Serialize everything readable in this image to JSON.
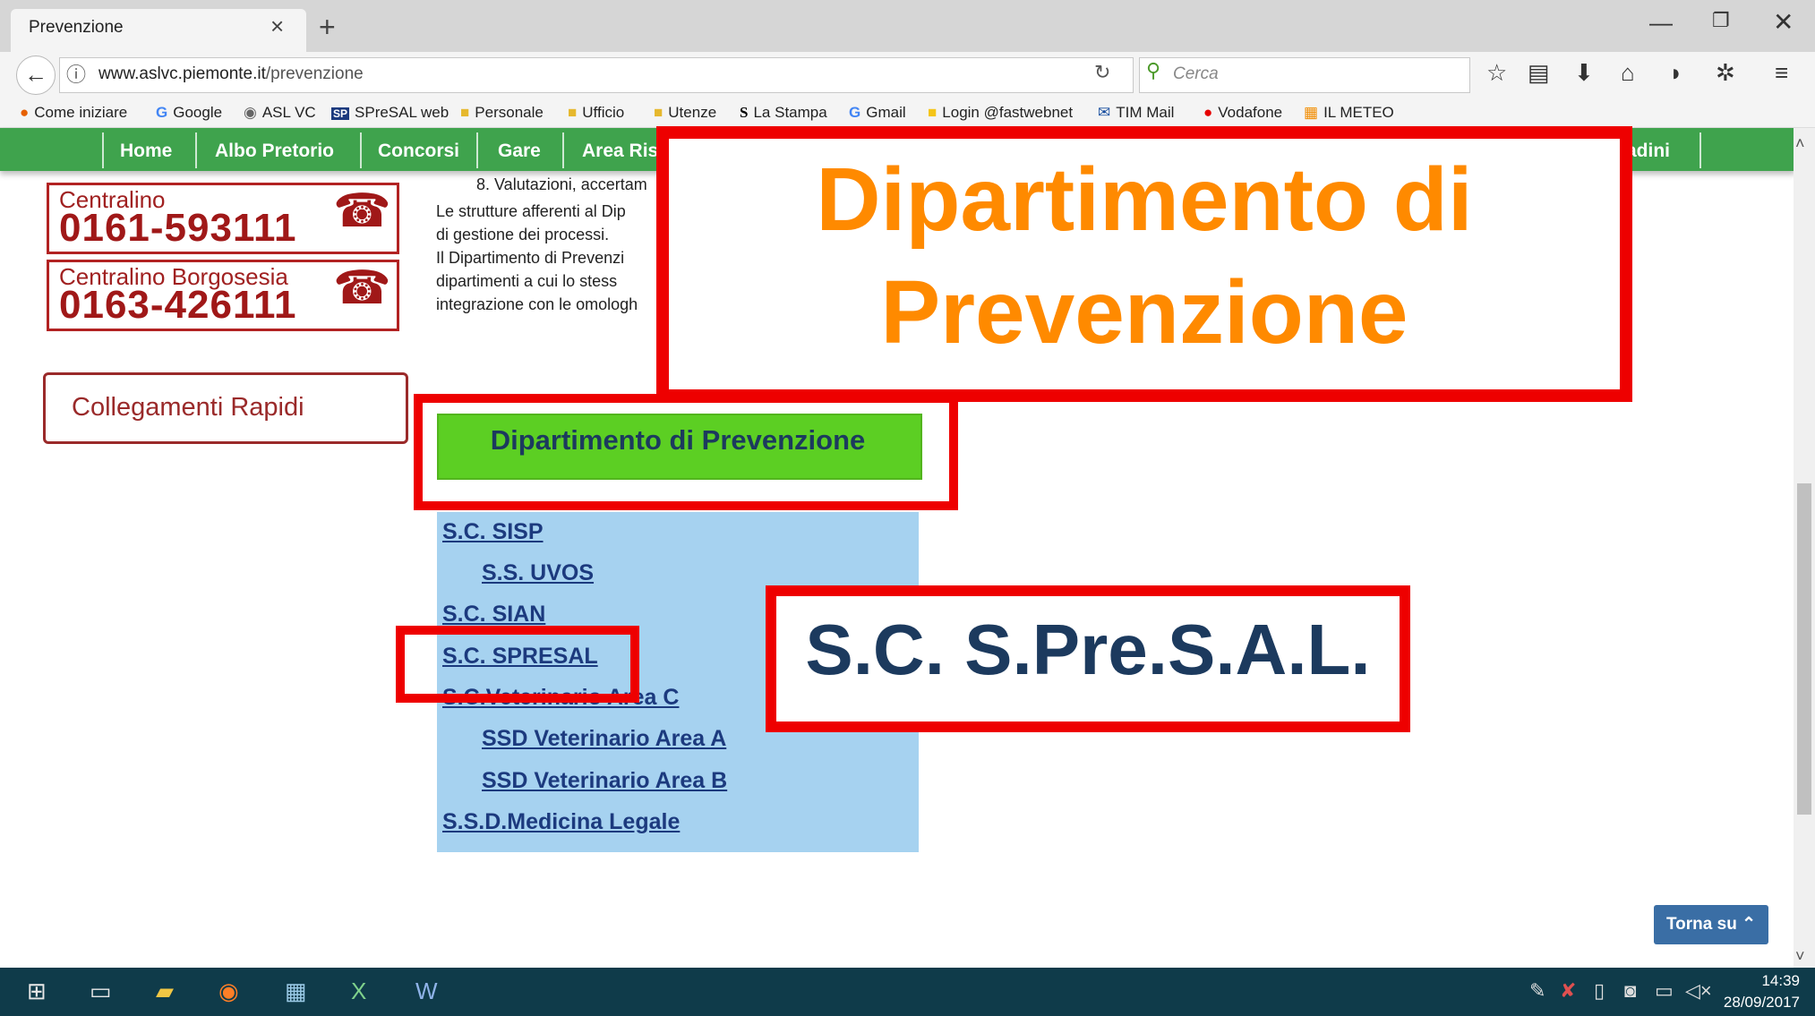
{
  "browser": {
    "tab_title": "Prevenzione",
    "url_host": "www.aslvc.piemonte.it",
    "url_path": "/prevenzione",
    "search_placeholder": "Cerca",
    "bookmarks": [
      "Come iniziare",
      "Google",
      "ASL VC",
      "SPreSAL web",
      "Personale",
      "Ufficio",
      "Utenze",
      "La Stampa",
      "Gmail",
      "Login @fastwebnet",
      "TIM Mail",
      "Vodafone",
      "IL METEO"
    ]
  },
  "site_menu": {
    "items": [
      "Home",
      "Albo Pretorio",
      "Concorsi",
      "Gare",
      "Area Ris",
      "ttadini"
    ]
  },
  "sidebar": {
    "phone1_label": "Centralino",
    "phone1_number": "0161-593111",
    "phone2_label": "Centralino Borgosesia",
    "phone2_number": "0163-426111",
    "quick_links": "Collegamenti Rapidi"
  },
  "content": {
    "lines": [
      "8. Valutazioni, accertam",
      "Le strutture afferenti al Dip",
      "di gestione dei processi.",
      "Il Dipartimento di Prevenzi",
      "dipartimenti a cui lo stess",
      "integrazione con le omologh"
    ],
    "dept_button": "Dipartimento di Prevenzione",
    "links": [
      "S.C. SISP",
      "S.S. UVOS",
      "S.C. SIAN",
      "S.C. SPRESAL",
      "S.C.Veterinario Area C",
      "SSD Veterinario Area A",
      "SSD Veterinario Area B",
      "S.S.D.Medicina Legale"
    ],
    "back_to_top": "Torna su"
  },
  "annotations": {
    "title_line1": "Dipartimento di",
    "title_line2": "Prevenzione",
    "spresal_label": "S.C. S.Pre.S.A.L."
  },
  "taskbar": {
    "time": "14:39",
    "date": "28/09/2017"
  },
  "colors": {
    "menu_green": "#3fa34d",
    "annotation_red": "#ee0000",
    "title_orange": "#ff8a00",
    "panel_blue": "#a6d2f0",
    "button_green": "#5ccf23"
  }
}
